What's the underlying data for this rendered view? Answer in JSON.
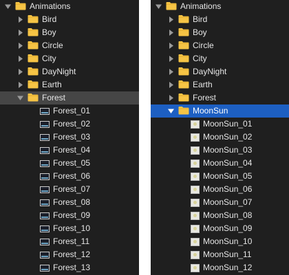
{
  "colors": {
    "panel_bg": "#1f1f1f",
    "text": "#e6e6e6",
    "folder": "#f6c445",
    "selection_gray": "#464646",
    "selection_blue": "#1d5fc2",
    "disclosure": "#9a9a9a"
  },
  "icons": {
    "disclosure_open": "triangle-down-icon",
    "disclosure_closed": "triangle-right-icon",
    "folder": "folder-icon",
    "image": "image-thumbnail-icon"
  },
  "left_panel": {
    "root": "Animations",
    "folders": [
      "Bird",
      "Boy",
      "Circle",
      "City",
      "DayNight",
      "Earth"
    ],
    "expanded_folder": "Forest",
    "files": [
      "Forest_01",
      "Forest_02",
      "Forest_03",
      "Forest_04",
      "Forest_05",
      "Forest_06",
      "Forest_07",
      "Forest_08",
      "Forest_09",
      "Forest_10",
      "Forest_11",
      "Forest_12",
      "Forest_13"
    ]
  },
  "right_panel": {
    "root": "Animations",
    "folders": [
      "Bird",
      "Boy",
      "Circle",
      "City",
      "DayNight",
      "Earth",
      "Forest"
    ],
    "expanded_folder": "MoonSun",
    "files": [
      "MoonSun_01",
      "MoonSun_02",
      "MoonSun_03",
      "MoonSun_04",
      "MoonSun_05",
      "MoonSun_06",
      "MoonSun_07",
      "MoonSun_08",
      "MoonSun_09",
      "MoonSun_10",
      "MoonSun_11",
      "MoonSun_12"
    ]
  }
}
